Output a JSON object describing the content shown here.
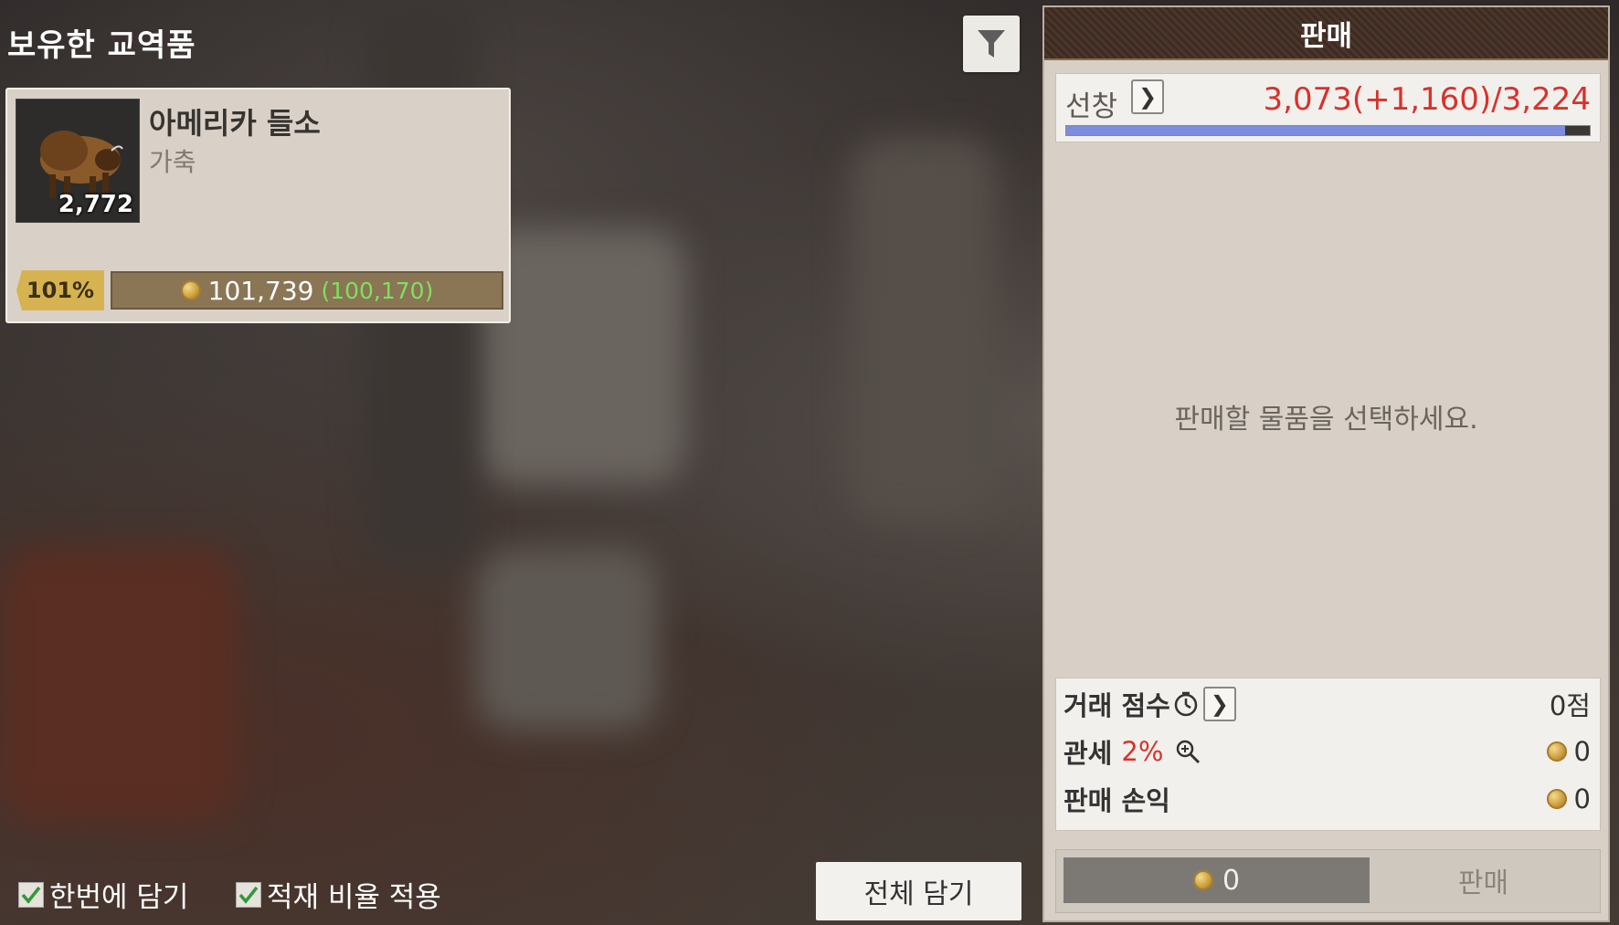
{
  "inventory": {
    "title": "보유한 교역품",
    "item": {
      "name": "아메리카 들소",
      "category": "가축",
      "quantity": "2,772",
      "percent": "101%",
      "price": "101,739",
      "base_price": "(100,170)"
    }
  },
  "options": {
    "load_at_once": "한번에 담기",
    "apply_ratio": "적재 비율 적용",
    "load_all": "전체 담기"
  },
  "sell_panel": {
    "title": "판매",
    "cargo_label": "선창",
    "cargo_value": "3,073(+1,160)/3,224",
    "cargo_fill": 0.953,
    "empty_message": "판매할 물품을 선택하세요.",
    "trade_score_label": "거래 점수",
    "trade_score_value": "0점",
    "tax_label": "관세",
    "tax_percent": "2%",
    "tax_value": "0",
    "profit_label": "판매 손익",
    "profit_value": "0",
    "sell_amount": "0",
    "sell_button": "판매"
  },
  "colors": {
    "accent_red": "#d8322c",
    "price_green": "#7fe05e",
    "gold": "#d6b350"
  }
}
